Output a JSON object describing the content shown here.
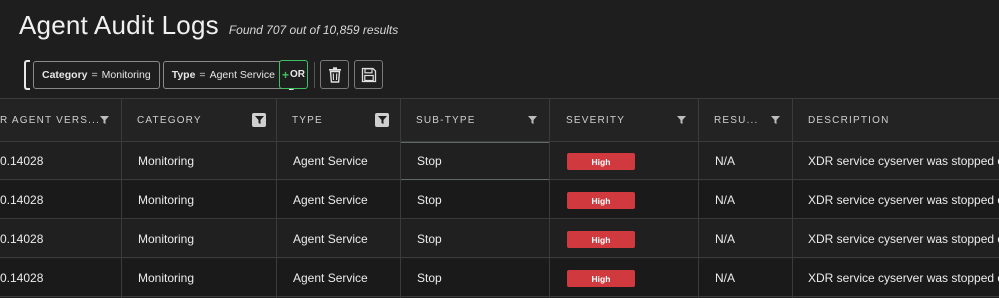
{
  "header": {
    "title": "Agent Audit Logs",
    "result_count": "Found 707 out of 10,859 results"
  },
  "filters": [
    {
      "key": "Category",
      "op": "=",
      "value": "Monitoring"
    },
    {
      "key": "Type",
      "op": "=",
      "value": "Agent Service"
    }
  ],
  "toolbar": {
    "or_label": "OR",
    "delete_icon": "trash-icon",
    "save_icon": "save-icon"
  },
  "table": {
    "columns": [
      "R AGENT VERS...",
      "CATEGORY",
      "TYPE",
      "SUB-TYPE",
      "SEVERITY",
      "RESU...",
      "DESCRIPTION"
    ],
    "rows": [
      {
        "agent_version": "0.14028",
        "category": "Monitoring",
        "type": "Agent Service",
        "sub_type": "Stop",
        "severity": "High",
        "result": "N/A",
        "description": "XDR service cyserver was stopped on"
      },
      {
        "agent_version": "0.14028",
        "category": "Monitoring",
        "type": "Agent Service",
        "sub_type": "Stop",
        "severity": "High",
        "result": "N/A",
        "description": "XDR service cyserver was stopped on"
      },
      {
        "agent_version": "0.14028",
        "category": "Monitoring",
        "type": "Agent Service",
        "sub_type": "Stop",
        "severity": "High",
        "result": "N/A",
        "description": "XDR service cyserver was stopped on"
      },
      {
        "agent_version": "0.14028",
        "category": "Monitoring",
        "type": "Agent Service",
        "sub_type": "Stop",
        "severity": "High",
        "result": "N/A",
        "description": "XDR service cyserver was stopped on"
      }
    ]
  },
  "colors": {
    "background": "#1e1e1e",
    "severity_high": "#d03a3f",
    "or_accent": "#3fc163"
  }
}
